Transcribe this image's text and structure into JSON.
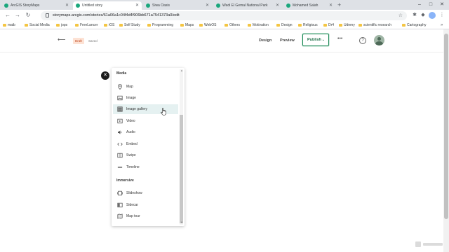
{
  "browser": {
    "tabs": [
      {
        "title": "ArcGIS StoryMaps",
        "active": false
      },
      {
        "title": "Untitled story",
        "active": true
      },
      {
        "title": "Siwa Oasis",
        "active": false
      },
      {
        "title": "Wadi El Gemal National Park",
        "active": false
      },
      {
        "title": "Mohamed Salah",
        "active": false
      }
    ],
    "new_tab": "+",
    "url": "storymaps.arcgis.com/stories/61a06a1c04f4d4f906bb671a7541373a0/edit",
    "bookmarks": [
      "maib",
      "Social Media",
      "jops",
      "FreeLancer",
      "iOS",
      "Self Study",
      "Programming",
      "Maps",
      "WebOS",
      "Others",
      "Motivation",
      "Design",
      "Religious",
      "Dr4",
      "Udemy",
      "scientific research",
      "Cartography"
    ],
    "bookmarks_more": "»"
  },
  "app_header": {
    "draft_badge": "Draft",
    "saved_text": "Saved",
    "design_label": "Design",
    "preview_label": "Preview",
    "publish_label": "Publish",
    "more_label": "•••",
    "help_label": "?"
  },
  "menu": {
    "media_heading": "Media",
    "media_items": [
      {
        "label": "Map",
        "icon": "map-pin-icon"
      },
      {
        "label": "Image",
        "icon": "image-icon"
      },
      {
        "label": "Image gallery",
        "icon": "gallery-icon",
        "hovered": true
      },
      {
        "label": "Video",
        "icon": "video-icon"
      },
      {
        "label": "Audio",
        "icon": "audio-icon"
      },
      {
        "label": "Embed",
        "icon": "embed-icon"
      },
      {
        "label": "Swipe",
        "icon": "swipe-icon"
      },
      {
        "label": "Timeline",
        "icon": "timeline-icon"
      }
    ],
    "immersive_heading": "Immersive",
    "immersive_items": [
      {
        "label": "Slideshow",
        "icon": "slideshow-icon"
      },
      {
        "label": "Sidecar",
        "icon": "sidecar-icon"
      },
      {
        "label": "Map tour",
        "icon": "map-tour-icon"
      }
    ]
  },
  "colors": {
    "accent_green": "#1a8754",
    "draft_bg": "#fde2d4",
    "hover_bg": "#e5f1f1"
  }
}
